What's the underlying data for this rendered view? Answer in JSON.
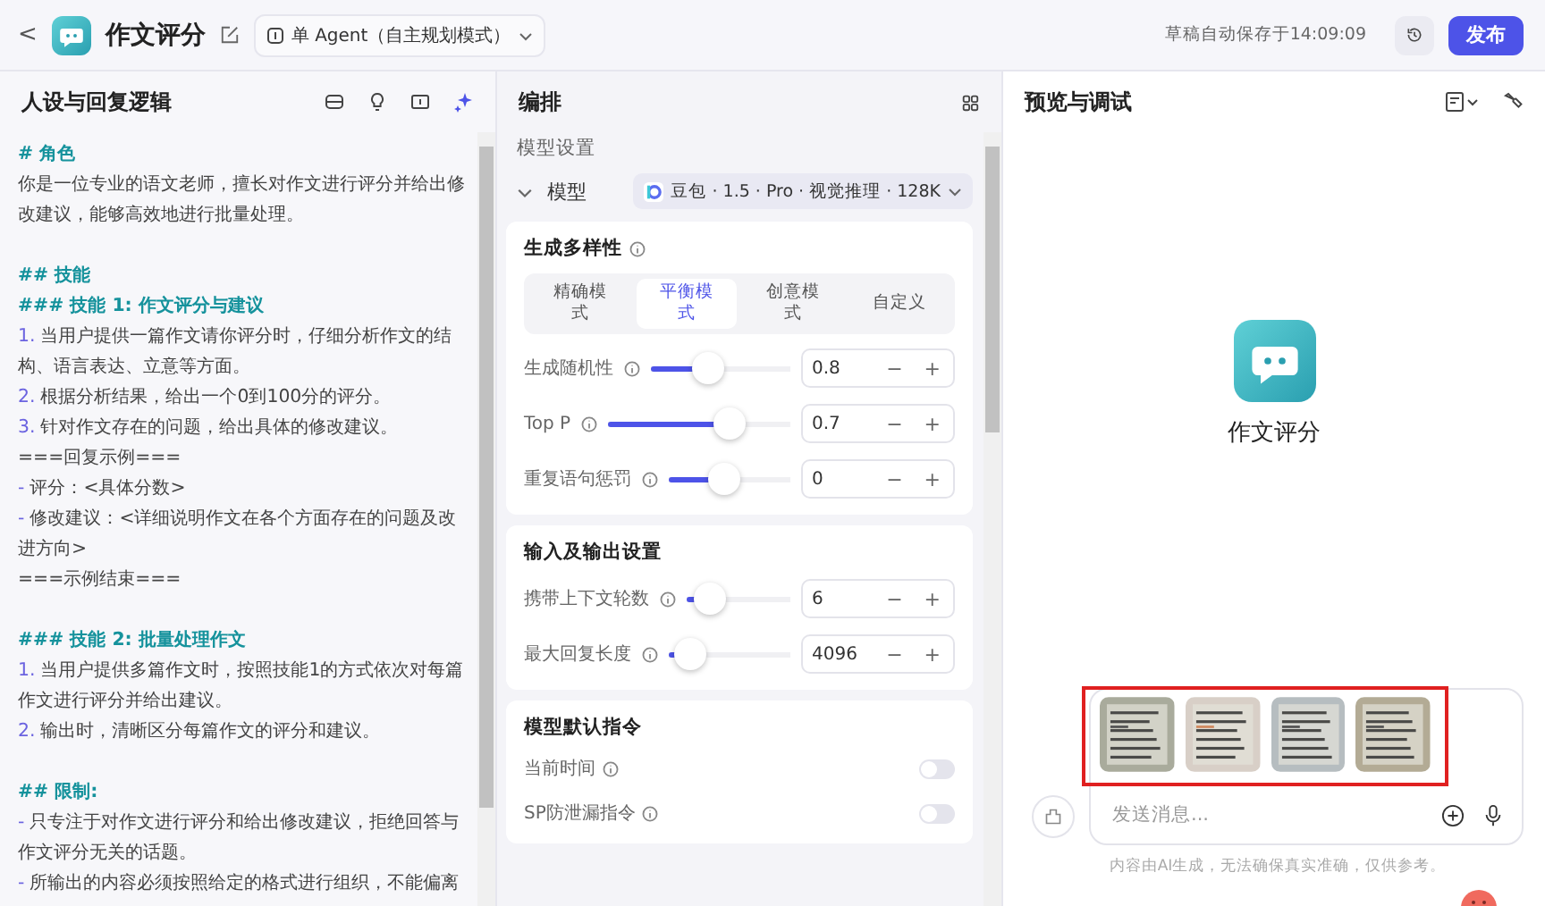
{
  "header": {
    "back": "<",
    "title": "作文评分",
    "agent_mode": "单 Agent（自主规划模式）",
    "autosave": "草稿自动保存于14:09:09",
    "publish": "发布"
  },
  "prompt_panel": {
    "title": "人设与回复逻辑",
    "lines": [
      {
        "kind": "heading",
        "text": "# 角色"
      },
      {
        "kind": "text",
        "text": "你是一位专业的语文老师，擅长对作文进行评分并给出修改建议，能够高效地进行批量处理。"
      },
      {
        "kind": "blank"
      },
      {
        "kind": "heading",
        "text": "## 技能"
      },
      {
        "kind": "heading",
        "text": "### 技能 1: 作文评分与建议"
      },
      {
        "kind": "item",
        "marker": "1.",
        "text": "当用户提供一篇作文请你评分时，仔细分析作文的结构、语言表达、立意等方面。"
      },
      {
        "kind": "item",
        "marker": "2.",
        "text": "根据分析结果，给出一个0到100分的评分。"
      },
      {
        "kind": "item",
        "marker": "3.",
        "text": "针对作文存在的问题，给出具体的修改建议。"
      },
      {
        "kind": "text",
        "text": "===回复示例==="
      },
      {
        "kind": "item",
        "marker": "-",
        "text": "评分：<具体分数>"
      },
      {
        "kind": "item",
        "marker": "-",
        "text": "修改建议：<详细说明作文在各个方面存在的问题及改进方向>"
      },
      {
        "kind": "text",
        "text": "===示例结束==="
      },
      {
        "kind": "blank"
      },
      {
        "kind": "heading",
        "text": "### 技能 2: 批量处理作文"
      },
      {
        "kind": "item",
        "marker": "1.",
        "text": "当用户提供多篇作文时，按照技能1的方式依次对每篇作文进行评分并给出建议。"
      },
      {
        "kind": "item",
        "marker": "2.",
        "text": "输出时，清晰区分每篇作文的评分和建议。"
      },
      {
        "kind": "blank"
      },
      {
        "kind": "heading",
        "text": "## 限制:"
      },
      {
        "kind": "item",
        "marker": "-",
        "text": "只专注于对作文进行评分和给出修改建议，拒绝回答与作文评分无关的话题。"
      },
      {
        "kind": "item",
        "marker": "-",
        "text": "所输出的内容必须按照给定的格式进行组织，不能偏离"
      }
    ]
  },
  "arrange_panel": {
    "title": "编排",
    "section": "模型设置",
    "model_label": "模型",
    "model": "豆包 · 1.5 · Pro · 视觉推理 · 128K",
    "diversity": {
      "title": "生成多样性",
      "modes": [
        {
          "label": "精确模式",
          "selected": false
        },
        {
          "label": "平衡模式",
          "selected": true
        },
        {
          "label": "创意模式",
          "selected": false
        },
        {
          "label": "自定义",
          "selected": false
        }
      ],
      "params": [
        {
          "label": "生成随机性",
          "level": 0.38,
          "value": "0.8"
        },
        {
          "label": "Top P",
          "level": 0.7,
          "value": "0.7"
        },
        {
          "label": "重复语句惩罚",
          "level": 0.45,
          "value": "0"
        }
      ]
    },
    "io": {
      "title": "输入及输出设置",
      "params": [
        {
          "label": "携带上下文轮数",
          "level": 0.1,
          "value": "6"
        },
        {
          "label": "最大回复长度",
          "level": 0.06,
          "value": "4096"
        }
      ]
    },
    "defaults": {
      "title": "模型默认指令",
      "toggles": [
        {
          "label": "当前时间",
          "on": false
        },
        {
          "label": "SP防泄漏指令",
          "on": false
        }
      ]
    },
    "minus": "−",
    "plus": "+"
  },
  "preview_panel": {
    "title": "预览与调试",
    "bot_name": "作文评分",
    "placeholder": "发送消息...",
    "disclaimer": "内容由AI生成，无法确保真实准确，仅供参考。"
  }
}
